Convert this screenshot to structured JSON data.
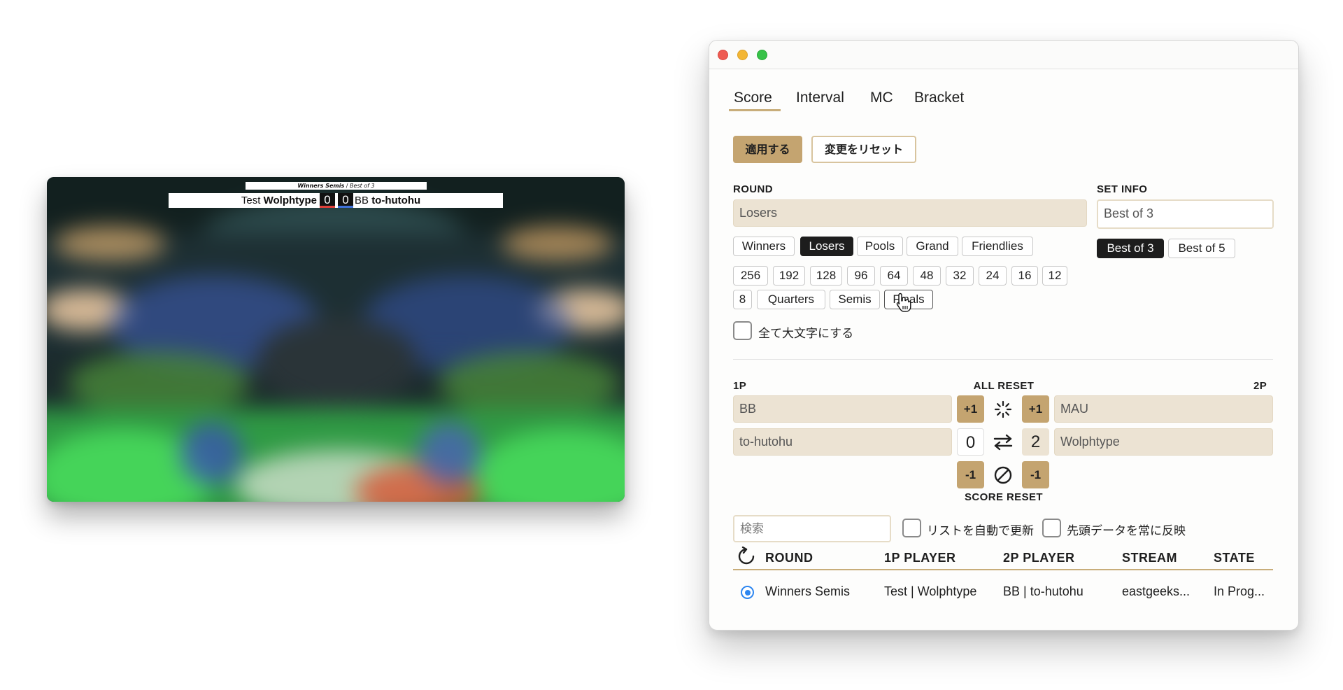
{
  "preview": {
    "round_name": "Winners Semis",
    "round_sep": " / ",
    "set_info": "Best of 3",
    "p1_team": "Test",
    "p1_name": "Wolphtype",
    "p1_score": "0",
    "p2_score": "0",
    "p2_team": "BB",
    "p2_name": "to-hutohu",
    "colors": {
      "p1": "#e0403a",
      "p2": "#3f71d9"
    }
  },
  "window": {
    "tabs": [
      "Score",
      "Interval",
      "MC",
      "Bracket"
    ],
    "active_tab": "Score",
    "apply_label": "適用する",
    "reset_changes_label": "変更をリセット",
    "round_label": "ROUND",
    "round_value": "Losers",
    "set_info_label": "SET INFO",
    "set_info_value": "Best of 3",
    "round_type_chips": [
      "Winners",
      "Losers",
      "Pools",
      "Grand",
      "Friendlies"
    ],
    "active_round_type": "Losers",
    "set_chips": [
      "Best of 3",
      "Best of 5"
    ],
    "active_set_chip": "Best of 3",
    "round_number_chips_row1": [
      "256",
      "192",
      "128",
      "96",
      "64",
      "48",
      "32",
      "24",
      "16",
      "12"
    ],
    "round_number_chips_row2": [
      "8",
      "Quarters",
      "Semis",
      "Finals"
    ],
    "uppercase_label": "全て大文字にする",
    "p1_label": "1P",
    "all_reset_label": "ALL RESET",
    "p2_label": "2P",
    "p1_team": "BB",
    "p1_name": "to-hutohu",
    "p2_team": "MAU",
    "p2_name": "Wolphtype",
    "plus_label": "+1",
    "minus_label": "-1",
    "p1_score": "0",
    "p2_score": "2",
    "score_reset_label": "SCORE RESET",
    "search_placeholder": "検索",
    "auto_update_label": "リストを自動で更新",
    "always_reflect_label": "先頭データを常に反映",
    "table_headers": [
      "ROUND",
      "1P PLAYER",
      "2P PLAYER",
      "STREAM",
      "STATE"
    ],
    "table_rows": [
      {
        "round": "Winners Semis",
        "p1": "Test | Wolphtype",
        "p2": "BB | to-hutohu",
        "stream": "eastgeeks...",
        "state": "In Prog..."
      }
    ],
    "accent_color": "#c4a470"
  }
}
